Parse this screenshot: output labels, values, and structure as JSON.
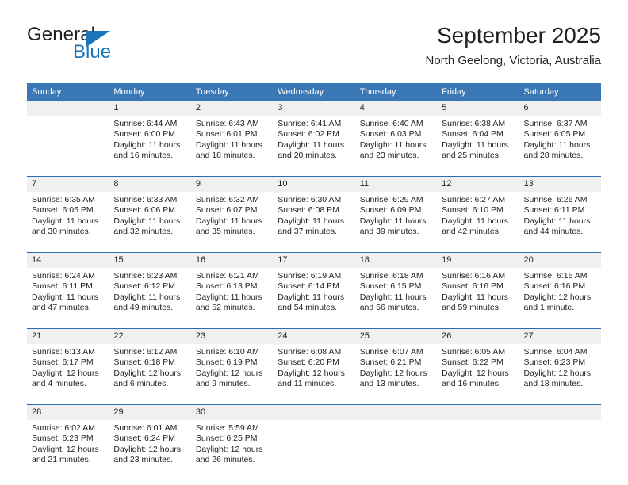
{
  "brand": {
    "name_top": "General",
    "name_bottom": "Blue",
    "accent_color": "#1b75bb"
  },
  "header": {
    "month_title": "September 2025",
    "location": "North Geelong, Victoria, Australia"
  },
  "calendar": {
    "header_background": "#3a78b5",
    "daynum_background": "#f0f0f0",
    "separator_color": "#2b6cab",
    "weekday_headers": [
      "Sunday",
      "Monday",
      "Tuesday",
      "Wednesday",
      "Thursday",
      "Friday",
      "Saturday"
    ],
    "weeks": [
      [
        {
          "day": "",
          "sunrise": "",
          "sunset": "",
          "daylight_line1": "",
          "daylight_line2": ""
        },
        {
          "day": "1",
          "sunrise": "Sunrise: 6:44 AM",
          "sunset": "Sunset: 6:00 PM",
          "daylight_line1": "Daylight: 11 hours",
          "daylight_line2": "and 16 minutes."
        },
        {
          "day": "2",
          "sunrise": "Sunrise: 6:43 AM",
          "sunset": "Sunset: 6:01 PM",
          "daylight_line1": "Daylight: 11 hours",
          "daylight_line2": "and 18 minutes."
        },
        {
          "day": "3",
          "sunrise": "Sunrise: 6:41 AM",
          "sunset": "Sunset: 6:02 PM",
          "daylight_line1": "Daylight: 11 hours",
          "daylight_line2": "and 20 minutes."
        },
        {
          "day": "4",
          "sunrise": "Sunrise: 6:40 AM",
          "sunset": "Sunset: 6:03 PM",
          "daylight_line1": "Daylight: 11 hours",
          "daylight_line2": "and 23 minutes."
        },
        {
          "day": "5",
          "sunrise": "Sunrise: 6:38 AM",
          "sunset": "Sunset: 6:04 PM",
          "daylight_line1": "Daylight: 11 hours",
          "daylight_line2": "and 25 minutes."
        },
        {
          "day": "6",
          "sunrise": "Sunrise: 6:37 AM",
          "sunset": "Sunset: 6:05 PM",
          "daylight_line1": "Daylight: 11 hours",
          "daylight_line2": "and 28 minutes."
        }
      ],
      [
        {
          "day": "7",
          "sunrise": "Sunrise: 6:35 AM",
          "sunset": "Sunset: 6:05 PM",
          "daylight_line1": "Daylight: 11 hours",
          "daylight_line2": "and 30 minutes."
        },
        {
          "day": "8",
          "sunrise": "Sunrise: 6:33 AM",
          "sunset": "Sunset: 6:06 PM",
          "daylight_line1": "Daylight: 11 hours",
          "daylight_line2": "and 32 minutes."
        },
        {
          "day": "9",
          "sunrise": "Sunrise: 6:32 AM",
          "sunset": "Sunset: 6:07 PM",
          "daylight_line1": "Daylight: 11 hours",
          "daylight_line2": "and 35 minutes."
        },
        {
          "day": "10",
          "sunrise": "Sunrise: 6:30 AM",
          "sunset": "Sunset: 6:08 PM",
          "daylight_line1": "Daylight: 11 hours",
          "daylight_line2": "and 37 minutes."
        },
        {
          "day": "11",
          "sunrise": "Sunrise: 6:29 AM",
          "sunset": "Sunset: 6:09 PM",
          "daylight_line1": "Daylight: 11 hours",
          "daylight_line2": "and 39 minutes."
        },
        {
          "day": "12",
          "sunrise": "Sunrise: 6:27 AM",
          "sunset": "Sunset: 6:10 PM",
          "daylight_line1": "Daylight: 11 hours",
          "daylight_line2": "and 42 minutes."
        },
        {
          "day": "13",
          "sunrise": "Sunrise: 6:26 AM",
          "sunset": "Sunset: 6:11 PM",
          "daylight_line1": "Daylight: 11 hours",
          "daylight_line2": "and 44 minutes."
        }
      ],
      [
        {
          "day": "14",
          "sunrise": "Sunrise: 6:24 AM",
          "sunset": "Sunset: 6:11 PM",
          "daylight_line1": "Daylight: 11 hours",
          "daylight_line2": "and 47 minutes."
        },
        {
          "day": "15",
          "sunrise": "Sunrise: 6:23 AM",
          "sunset": "Sunset: 6:12 PM",
          "daylight_line1": "Daylight: 11 hours",
          "daylight_line2": "and 49 minutes."
        },
        {
          "day": "16",
          "sunrise": "Sunrise: 6:21 AM",
          "sunset": "Sunset: 6:13 PM",
          "daylight_line1": "Daylight: 11 hours",
          "daylight_line2": "and 52 minutes."
        },
        {
          "day": "17",
          "sunrise": "Sunrise: 6:19 AM",
          "sunset": "Sunset: 6:14 PM",
          "daylight_line1": "Daylight: 11 hours",
          "daylight_line2": "and 54 minutes."
        },
        {
          "day": "18",
          "sunrise": "Sunrise: 6:18 AM",
          "sunset": "Sunset: 6:15 PM",
          "daylight_line1": "Daylight: 11 hours",
          "daylight_line2": "and 56 minutes."
        },
        {
          "day": "19",
          "sunrise": "Sunrise: 6:16 AM",
          "sunset": "Sunset: 6:16 PM",
          "daylight_line1": "Daylight: 11 hours",
          "daylight_line2": "and 59 minutes."
        },
        {
          "day": "20",
          "sunrise": "Sunrise: 6:15 AM",
          "sunset": "Sunset: 6:16 PM",
          "daylight_line1": "Daylight: 12 hours",
          "daylight_line2": "and 1 minute."
        }
      ],
      [
        {
          "day": "21",
          "sunrise": "Sunrise: 6:13 AM",
          "sunset": "Sunset: 6:17 PM",
          "daylight_line1": "Daylight: 12 hours",
          "daylight_line2": "and 4 minutes."
        },
        {
          "day": "22",
          "sunrise": "Sunrise: 6:12 AM",
          "sunset": "Sunset: 6:18 PM",
          "daylight_line1": "Daylight: 12 hours",
          "daylight_line2": "and 6 minutes."
        },
        {
          "day": "23",
          "sunrise": "Sunrise: 6:10 AM",
          "sunset": "Sunset: 6:19 PM",
          "daylight_line1": "Daylight: 12 hours",
          "daylight_line2": "and 9 minutes."
        },
        {
          "day": "24",
          "sunrise": "Sunrise: 6:08 AM",
          "sunset": "Sunset: 6:20 PM",
          "daylight_line1": "Daylight: 12 hours",
          "daylight_line2": "and 11 minutes."
        },
        {
          "day": "25",
          "sunrise": "Sunrise: 6:07 AM",
          "sunset": "Sunset: 6:21 PM",
          "daylight_line1": "Daylight: 12 hours",
          "daylight_line2": "and 13 minutes."
        },
        {
          "day": "26",
          "sunrise": "Sunrise: 6:05 AM",
          "sunset": "Sunset: 6:22 PM",
          "daylight_line1": "Daylight: 12 hours",
          "daylight_line2": "and 16 minutes."
        },
        {
          "day": "27",
          "sunrise": "Sunrise: 6:04 AM",
          "sunset": "Sunset: 6:23 PM",
          "daylight_line1": "Daylight: 12 hours",
          "daylight_line2": "and 18 minutes."
        }
      ],
      [
        {
          "day": "28",
          "sunrise": "Sunrise: 6:02 AM",
          "sunset": "Sunset: 6:23 PM",
          "daylight_line1": "Daylight: 12 hours",
          "daylight_line2": "and 21 minutes."
        },
        {
          "day": "29",
          "sunrise": "Sunrise: 6:01 AM",
          "sunset": "Sunset: 6:24 PM",
          "daylight_line1": "Daylight: 12 hours",
          "daylight_line2": "and 23 minutes."
        },
        {
          "day": "30",
          "sunrise": "Sunrise: 5:59 AM",
          "sunset": "Sunset: 6:25 PM",
          "daylight_line1": "Daylight: 12 hours",
          "daylight_line2": "and 26 minutes."
        },
        {
          "day": "",
          "sunrise": "",
          "sunset": "",
          "daylight_line1": "",
          "daylight_line2": ""
        },
        {
          "day": "",
          "sunrise": "",
          "sunset": "",
          "daylight_line1": "",
          "daylight_line2": ""
        },
        {
          "day": "",
          "sunrise": "",
          "sunset": "",
          "daylight_line1": "",
          "daylight_line2": ""
        },
        {
          "day": "",
          "sunrise": "",
          "sunset": "",
          "daylight_line1": "",
          "daylight_line2": ""
        }
      ]
    ]
  }
}
